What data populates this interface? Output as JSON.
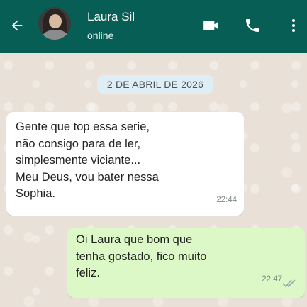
{
  "header": {
    "contact_name": "Laura Sil",
    "status": "online",
    "colors": {
      "bar": "#075e54",
      "text": "#ffffff"
    },
    "icons": [
      "back-arrow-icon",
      "video-call-icon",
      "phone-icon",
      "more-vert-icon"
    ]
  },
  "chat": {
    "date_label": "2 DE ABRIL DE 2026",
    "messages": [
      {
        "direction": "incoming",
        "text": "Gente que top essa serie,\nnão consigo para de ler,\nsimplesmente viciante...\nMeu Deus, vou bater nessa\nSophia.",
        "time": "22:44"
      },
      {
        "direction": "outgoing",
        "text": "Oi Laura que bom que\ntenha gostado, fico muito\nfeliz.",
        "time": "22:47",
        "status_icon": "double-check-icon"
      }
    ]
  }
}
